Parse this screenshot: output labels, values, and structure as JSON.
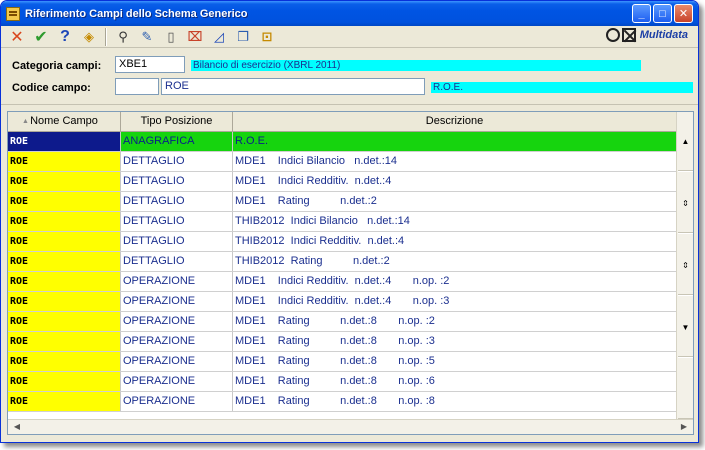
{
  "window": {
    "title": "Riferimento Campi dello Schema Generico"
  },
  "brand": {
    "name": "Multidata"
  },
  "form": {
    "categoria_label": "Categoria campi:",
    "categoria_code": "XBE1",
    "categoria_desc": "Bilancio di esercizio (XBRL 2011)",
    "codice_label": "Codice campo:",
    "codice_code": "",
    "codice_value": "ROE",
    "codice_desc": "R.O.E."
  },
  "grid": {
    "columns": [
      "Nome Campo",
      "Tipo Posizione",
      "Descrizione"
    ],
    "rows": [
      [
        "ROE",
        "ANAGRAFICA",
        "R.O.E."
      ],
      [
        "ROE",
        "DETTAGLIO",
        "MDE1    Indici Bilancio   n.det.:14"
      ],
      [
        "ROE",
        "DETTAGLIO",
        "MDE1    Indici Redditiv.  n.det.:4"
      ],
      [
        "ROE",
        "DETTAGLIO",
        "MDE1    Rating          n.det.:2"
      ],
      [
        "ROE",
        "DETTAGLIO",
        "THIB2012  Indici Bilancio   n.det.:14"
      ],
      [
        "ROE",
        "DETTAGLIO",
        "THIB2012  Indici Redditiv.  n.det.:4"
      ],
      [
        "ROE",
        "DETTAGLIO",
        "THIB2012  Rating          n.det.:2"
      ],
      [
        "ROE",
        "OPERAZIONE",
        "MDE1    Indici Redditiv.  n.det.:4       n.op. :2"
      ],
      [
        "ROE",
        "OPERAZIONE",
        "MDE1    Indici Redditiv.  n.det.:4       n.op. :3"
      ],
      [
        "ROE",
        "OPERAZIONE",
        "MDE1    Rating          n.det.:8       n.op. :2"
      ],
      [
        "ROE",
        "OPERAZIONE",
        "MDE1    Rating          n.det.:8       n.op. :3"
      ],
      [
        "ROE",
        "OPERAZIONE",
        "MDE1    Rating          n.det.:8       n.op. :5"
      ],
      [
        "ROE",
        "OPERAZIONE",
        "MDE1    Rating          n.det.:8       n.op. :6"
      ],
      [
        "ROE",
        "OPERAZIONE",
        "MDE1    Rating          n.det.:8       n.op. :8"
      ]
    ]
  },
  "icons": [
    "cancel-icon",
    "confirm-icon",
    "help-icon",
    "navigate-icon",
    "search-icon",
    "edit-icon",
    "new-document-icon",
    "delete-icon",
    "ruler-icon",
    "window-icon",
    "lock-icon"
  ],
  "colors": {
    "selected_row_key": "#0d1a8c",
    "selected_row": "#16d40e",
    "key_column": "#ffff00",
    "cyan_field": "#00ffff",
    "text_blue": "#1b2f8f"
  }
}
